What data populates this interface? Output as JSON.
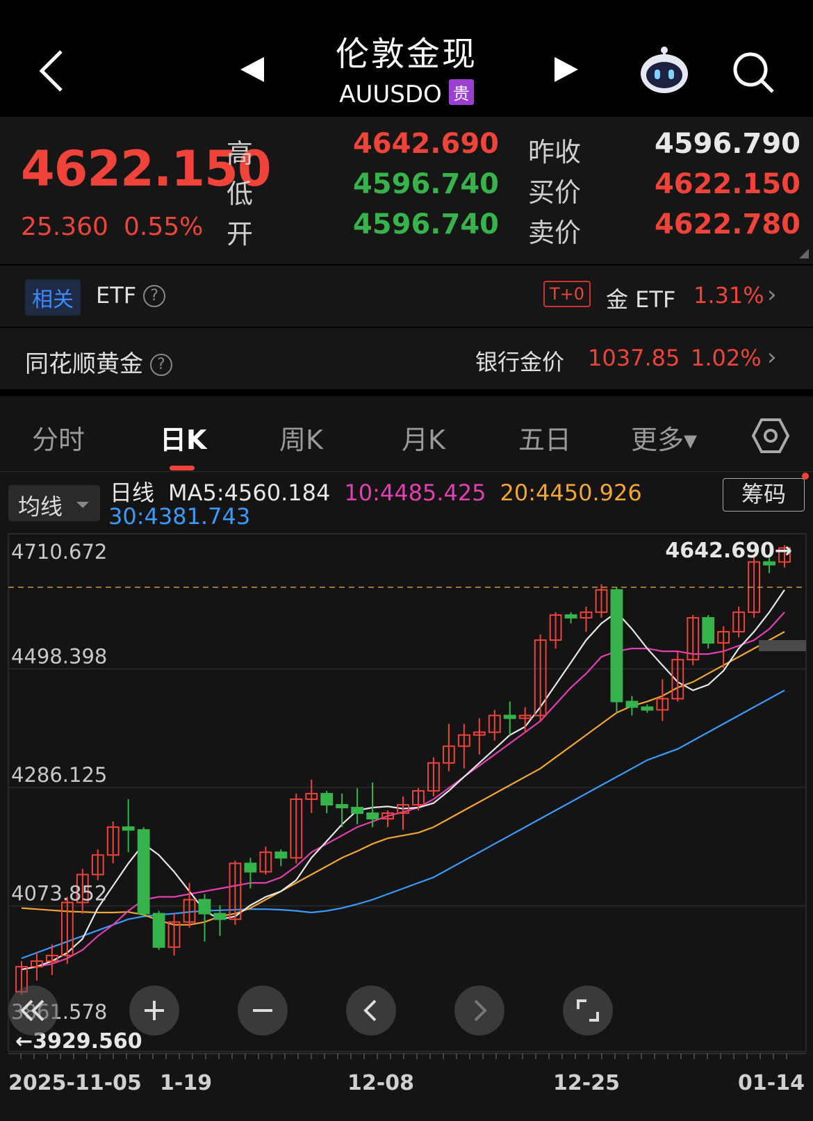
{
  "header": {
    "title": "伦敦金现",
    "code": "AUUSDO",
    "tag": "贵"
  },
  "quote": {
    "price": "4622.150",
    "change": "25.360",
    "change_pct": "0.55%",
    "high_label": "高",
    "high": "4642.690",
    "low_label": "低",
    "low": "4596.740",
    "open_label": "开",
    "open": "4596.740",
    "prev_close_label": "昨收",
    "prev_close": "4596.790",
    "bid_label": "买价",
    "bid": "4622.150",
    "ask_label": "卖价",
    "ask": "4622.780"
  },
  "related": {
    "tag": "相关",
    "label": "ETF",
    "help": "?",
    "t0": "T+0",
    "gold_etf_label": "金 ETF",
    "gold_etf_pct": "1.31%",
    "chevron": "›"
  },
  "ths": {
    "label": "同花顺黄金",
    "help": "?",
    "bank_label": "银行金价",
    "bank_value": "1037.85",
    "bank_pct": "1.02%",
    "chevron": "›"
  },
  "tabs": [
    {
      "label": "分时"
    },
    {
      "label": "日K"
    },
    {
      "label": "周K"
    },
    {
      "label": "月K"
    },
    {
      "label": "五日"
    },
    {
      "label": "更多▾"
    }
  ],
  "ma_bar": {
    "select_label": "均线",
    "line_label": "日线",
    "ma5": "MA5:4560.184",
    "ma10": "10:4485.425",
    "ma20": "20:4450.926",
    "ma30": "30:4381.743",
    "chip_button": "筹码"
  },
  "colors": {
    "up": "#f0443a",
    "down": "#36b34a",
    "ma5": "#e8e8e8",
    "ma10": "#e33fb2",
    "ma20": "#f3a633",
    "ma30": "#3a9bff"
  },
  "chart_data": {
    "type": "candlestick",
    "y_ticks": [
      "4710.672",
      "4498.398",
      "4286.125",
      "4073.852",
      "3861.578"
    ],
    "ylim": [
      3861.578,
      4710.672
    ],
    "x_ticks": [
      "2025-11-05",
      "1-19",
      "12-08",
      "12-25",
      "01-14"
    ],
    "high_marker": "4642.690→",
    "low_marker": "←3929.560",
    "candles": [
      {
        "o": 3920,
        "h": 3975,
        "l": 3915,
        "c": 3965
      },
      {
        "o": 3965,
        "h": 3990,
        "l": 3940,
        "c": 3975
      },
      {
        "o": 3975,
        "h": 4005,
        "l": 3950,
        "c": 3985
      },
      {
        "o": 3985,
        "h": 4090,
        "l": 3970,
        "c": 4080
      },
      {
        "o": 4080,
        "h": 4140,
        "l": 4060,
        "c": 4130
      },
      {
        "o": 4130,
        "h": 4175,
        "l": 4120,
        "c": 4165
      },
      {
        "o": 4165,
        "h": 4225,
        "l": 4150,
        "c": 4215
      },
      {
        "o": 4215,
        "h": 4265,
        "l": 4170,
        "c": 4210
      },
      {
        "o": 4210,
        "h": 4215,
        "l": 4055,
        "c": 4060
      },
      {
        "o": 4060,
        "h": 4065,
        "l": 3995,
        "c": 4000
      },
      {
        "o": 4000,
        "h": 4060,
        "l": 3985,
        "c": 4045
      },
      {
        "o": 4045,
        "h": 4115,
        "l": 4035,
        "c": 4085
      },
      {
        "o": 4085,
        "h": 4095,
        "l": 4010,
        "c": 4060
      },
      {
        "o": 4060,
        "h": 4075,
        "l": 4020,
        "c": 4050
      },
      {
        "o": 4050,
        "h": 4155,
        "l": 4040,
        "c": 4150
      },
      {
        "o": 4150,
        "h": 4160,
        "l": 4105,
        "c": 4135
      },
      {
        "o": 4135,
        "h": 4180,
        "l": 4130,
        "c": 4170
      },
      {
        "o": 4170,
        "h": 4175,
        "l": 4145,
        "c": 4160
      },
      {
        "o": 4160,
        "h": 4275,
        "l": 4150,
        "c": 4265
      },
      {
        "o": 4265,
        "h": 4300,
        "l": 4240,
        "c": 4275
      },
      {
        "o": 4275,
        "h": 4280,
        "l": 4240,
        "c": 4255
      },
      {
        "o": 4255,
        "h": 4275,
        "l": 4215,
        "c": 4250
      },
      {
        "o": 4250,
        "h": 4285,
        "l": 4220,
        "c": 4240
      },
      {
        "o": 4240,
        "h": 4295,
        "l": 4215,
        "c": 4230
      },
      {
        "o": 4230,
        "h": 4245,
        "l": 4215,
        "c": 4240
      },
      {
        "o": 4240,
        "h": 4270,
        "l": 4210,
        "c": 4255
      },
      {
        "o": 4255,
        "h": 4285,
        "l": 4245,
        "c": 4280
      },
      {
        "o": 4280,
        "h": 4340,
        "l": 4270,
        "c": 4330
      },
      {
        "o": 4330,
        "h": 4400,
        "l": 4315,
        "c": 4360
      },
      {
        "o": 4360,
        "h": 4400,
        "l": 4320,
        "c": 4380
      },
      {
        "o": 4380,
        "h": 4410,
        "l": 4345,
        "c": 4385
      },
      {
        "o": 4385,
        "h": 4425,
        "l": 4370,
        "c": 4415
      },
      {
        "o": 4415,
        "h": 4440,
        "l": 4380,
        "c": 4410
      },
      {
        "o": 4410,
        "h": 4430,
        "l": 4385,
        "c": 4415
      },
      {
        "o": 4415,
        "h": 4560,
        "l": 4405,
        "c": 4550
      },
      {
        "o": 4550,
        "h": 4600,
        "l": 4535,
        "c": 4595
      },
      {
        "o": 4595,
        "h": 4600,
        "l": 4580,
        "c": 4590
      },
      {
        "o": 4590,
        "h": 4610,
        "l": 4565,
        "c": 4600
      },
      {
        "o": 4600,
        "h": 4650,
        "l": 4590,
        "c": 4640
      },
      {
        "o": 4640,
        "h": 4645,
        "l": 4420,
        "c": 4440
      },
      {
        "o": 4440,
        "h": 4450,
        "l": 4415,
        "c": 4430
      },
      {
        "o": 4430,
        "h": 4435,
        "l": 4420,
        "c": 4425
      },
      {
        "o": 4425,
        "h": 4480,
        "l": 4405,
        "c": 4445
      },
      {
        "o": 4445,
        "h": 4530,
        "l": 4440,
        "c": 4515
      },
      {
        "o": 4515,
        "h": 4595,
        "l": 4505,
        "c": 4590
      },
      {
        "o": 4590,
        "h": 4595,
        "l": 4535,
        "c": 4545
      },
      {
        "o": 4545,
        "h": 4575,
        "l": 4500,
        "c": 4565
      },
      {
        "o": 4565,
        "h": 4610,
        "l": 4555,
        "c": 4600
      },
      {
        "o": 4600,
        "h": 4700,
        "l": 4590,
        "c": 4690
      },
      {
        "o": 4690,
        "h": 4705,
        "l": 4670,
        "c": 4685
      },
      {
        "o": 4690,
        "h": 4720,
        "l": 4680,
        "c": 4715
      }
    ],
    "ma5": [
      3960,
      3965,
      3975,
      3990,
      4015,
      4070,
      4110,
      4150,
      4185,
      4165,
      4135,
      4100,
      4065,
      4050,
      4055,
      4075,
      4090,
      4100,
      4120,
      4160,
      4190,
      4220,
      4245,
      4250,
      4252,
      4248,
      4250,
      4258,
      4280,
      4305,
      4330,
      4355,
      4380,
      4395,
      4430,
      4470,
      4510,
      4550,
      4580,
      4600,
      4570,
      4535,
      4505,
      4475,
      4460,
      4470,
      4495,
      4535,
      4565,
      4600,
      4640
    ],
    "ma10": [
      3960,
      3965,
      3970,
      3980,
      3995,
      4020,
      4040,
      4065,
      4085,
      4090,
      4090,
      4095,
      4100,
      4105,
      4110,
      4115,
      4115,
      4125,
      4145,
      4170,
      4185,
      4200,
      4215,
      4225,
      4235,
      4242,
      4250,
      4265,
      4285,
      4305,
      4325,
      4345,
      4365,
      4385,
      4405,
      4435,
      4465,
      4490,
      4520,
      4530,
      4535,
      4535,
      4530,
      4530,
      4525,
      4525,
      4530,
      4540,
      4550,
      4570,
      4600
    ],
    "ma20": [
      4070,
      4068,
      4066,
      4064,
      4063,
      4062,
      4062,
      4063,
      4058,
      4048,
      4040,
      4040,
      4045,
      4055,
      4060,
      4070,
      4085,
      4100,
      4115,
      4130,
      4145,
      4160,
      4172,
      4185,
      4195,
      4200,
      4205,
      4215,
      4230,
      4245,
      4260,
      4275,
      4290,
      4305,
      4320,
      4340,
      4360,
      4380,
      4400,
      4420,
      4432,
      4440,
      4450,
      4465,
      4475,
      4490,
      4505,
      4520,
      4535,
      4550,
      4565
    ],
    "ma30": [
      3980,
      3990,
      4000,
      4010,
      4020,
      4030,
      4040,
      4050,
      4055,
      4058,
      4060,
      4063,
      4065,
      4066,
      4067,
      4068,
      4068,
      4067,
      4065,
      4062,
      4065,
      4070,
      4077,
      4085,
      4095,
      4105,
      4115,
      4125,
      4140,
      4155,
      4170,
      4185,
      4200,
      4215,
      4230,
      4245,
      4260,
      4275,
      4290,
      4305,
      4320,
      4335,
      4345,
      4355,
      4370,
      4385,
      4400,
      4415,
      4430,
      4445,
      4460
    ]
  },
  "controls": [
    "rewind",
    "zoom-in",
    "zoom-out",
    "prev",
    "next",
    "fullscreen"
  ]
}
